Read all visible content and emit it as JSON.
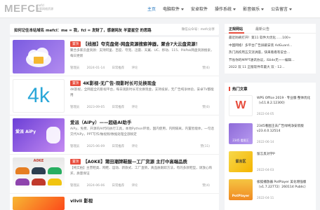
{
  "header": {
    "logo": "MEFCL",
    "logo_sub_1": "mefcl",
    "logo_sub_2": "分享网络资源",
    "nav": [
      {
        "label": "主页",
        "active": true
      },
      {
        "label": "电脑软件",
        "dropdown": true
      },
      {
        "label": "安卓软件"
      },
      {
        "label": "操作系统",
        "dropdown": true
      },
      {
        "label": "影音娱乐",
        "dropdown": true
      },
      {
        "label": "公告留言",
        "dropdown": true
      }
    ]
  },
  "notice": {
    "title": "如何记住本站域名 mefcl：me = 我，fcl = 发财了，感谢网友 羊望星空 的思路",
    "side": "微信公众号：mefc分享"
  },
  "posts": [
    {
      "tag": "置顶",
      "title": "【线报】夸克盘佬-网盘资源搜索神器，聚合7大云盘资源！",
      "excerpt": "聚合多家云盘资源：支持阿里、百度、夸克、迅雷、天翼、UC、移动、115、PikPak网盘资源搜索，每日更新",
      "author": "管理员",
      "date": "2024-01-14",
      "category": "日常推荐",
      "comments": "评论",
      "count": "赞(6)",
      "thumb_text": ""
    },
    {
      "tag": "置顶",
      "title": "4K影视-无广告-观影时长可兑换现金",
      "excerpt": "4K影视，全网超全的影视平台，每日观影时长可兑换现金，支持投屏，无广告纯净体验，安卓TV都能用",
      "author": "管理员",
      "date": "2023-09-05",
      "category": "日常推荐",
      "comments": "评论",
      "count": "赞(0)",
      "thumb_text": "4k"
    },
    {
      "tag": "",
      "title": "爱派（AiPy）——超级AI助手",
      "excerpt": "AiPy，免费、开源的AI代码执行工具，本地Python环境，国内使用，内网隔离，内置智能体，一句话交代AiPy，PPT写作/做视频/数据处理全部搞定",
      "author": "管理员",
      "date": "2025-06-09",
      "category": "日常推荐",
      "comments": "评论",
      "count": "赞(11)",
      "thumb_text": "爱派 AiPy"
    },
    {
      "tag": "置顶",
      "title": "【A0KE】莆田潮牌鞋服—工厂货源 主打中高端品质",
      "excerpt": "【纯实拍】主营鞋类、网鞋、运动、新款式、工厂直销，真品质跟踪方法，有的多款鞋型，请放心购买，质量保证",
      "author": "管理员",
      "date": "2024-06-06",
      "category": "日常推荐",
      "comments": "评论",
      "count": "赞(4)",
      "thumb_text": "A0KE"
    },
    {
      "tag": "",
      "title": "vlivii 影视",
      "excerpt": "",
      "author": "",
      "date": "",
      "category": "",
      "comments": "",
      "count": "",
      "thumb_text": ""
    }
  ],
  "sidebar": {
    "tabs": [
      "正规网站",
      "最新公告"
    ],
    "items": [
      "最近防刷打开！第11 软件大优化……100+",
      "中国网络！多平台广告屏蔽安装 AdGuard…",
      "热门高校周五交流讲座，快来看看有说合…",
      "节省你的MPPT通讯协议，iSlide无一一编辑…",
      "2022 双 11 正版软件年最大 双 - 12…"
    ]
  },
  "hot": {
    "title": "热门文章",
    "items": [
      {
        "title": "WPS Office 2019 · 专业版·整体优化（v11.8.2.12300）",
        "date": "2022-04-05",
        "thumb_text": "W"
      },
      {
        "title": "2345看图王去广告绿纯净安装版 v23.4.0.12514",
        "date": "2022-06-14",
        "thumb_text": "2345 看图王"
      },
      {
        "title": "留言反对学P",
        "date": "2022-04-03",
        "thumb_text": "留言区"
      },
      {
        "title": "极狐播放器 PotPlayer 美化增强版（v1.7.22772）260114 Public）",
        "date": "2022-04-11",
        "thumb_text": "PotPlayer"
      }
    ]
  },
  "colors": {
    "accent": "#1e73be",
    "tag": "#e74c3c"
  }
}
